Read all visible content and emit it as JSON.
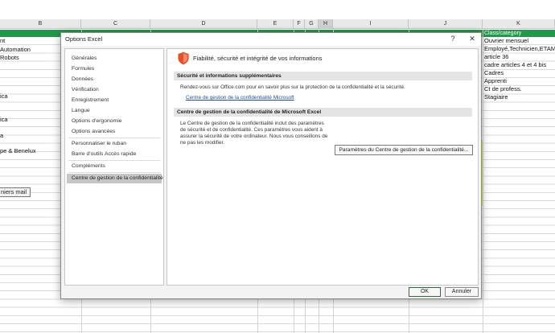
{
  "sheet": {
    "columns": [
      "B",
      "C",
      "D",
      "E",
      "F",
      "G",
      "H",
      "I",
      "J",
      "K"
    ],
    "selected_column": "H",
    "b_cells": [
      "nt",
      "Automation",
      "Robots",
      "ica",
      "ica",
      "a",
      "pe & Benelux"
    ],
    "k_header": "Class/category",
    "k_cells": [
      "Ouvrier mensuel",
      "Employé,Technicien,ETAM",
      "article 36",
      "cadre articles 4 et 4 bis",
      "Cadres",
      "Apprenti",
      "Ct de profess.",
      "Stagiaire"
    ],
    "sheet_button_label": "niers mail",
    "accent_green": "#1f9a48",
    "highlight_yellow": "#e7ef50"
  },
  "dialog": {
    "title": "Options Excel",
    "help_label": "?",
    "close_label": "✕",
    "nav_items": [
      "Générales",
      "Formules",
      "Données",
      "Vérification",
      "Enregistrement",
      "Langue",
      "Options d'ergonomie",
      "Options avancées",
      "Personnaliser le ruban",
      "Barre d'outils Accès rapide",
      "Compléments",
      "Centre de gestion de la confidentialité"
    ],
    "active_nav": "Centre de gestion de la confidentialité",
    "heading": "Fiabilité, sécurité et intégrité de vos informations",
    "section1": {
      "title": "Sécurité et informations supplémentaires",
      "text": "Rendez-vous sur Office.com pour en savoir plus sur la protection de la confidentialité et la sécurité.",
      "link": "Centre de gestion de la confidentialité Microsoft"
    },
    "section2": {
      "title": "Centre de gestion de la confidentialité de Microsoft Excel",
      "text": "Le Centre de gestion de la confidentialité inclut des paramètres de sécurité et de confidentialité. Ces paramètres vous aident à assurer la sécurité de votre ordinateur. Nous vous conseillons de ne pas les modifier.",
      "button": "Paramètres du Centre de gestion de la confidentialité..."
    },
    "ok_label": "OK",
    "cancel_label": "Annuler",
    "shield_color": "#e5502b"
  }
}
